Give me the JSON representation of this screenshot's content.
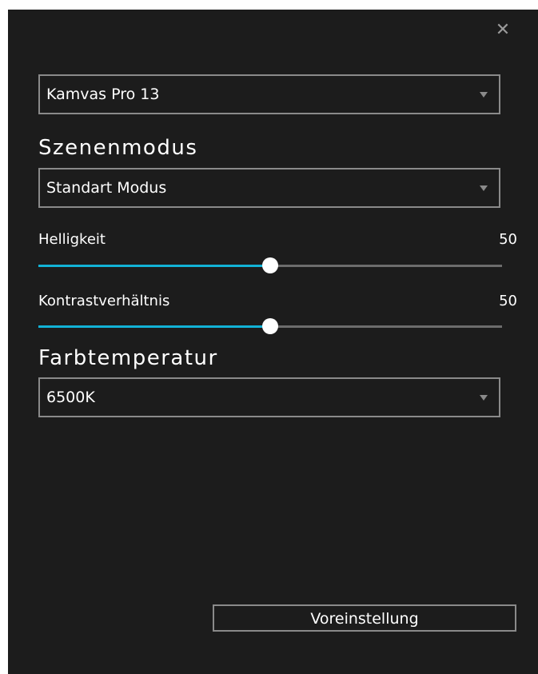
{
  "close_icon": "close-icon",
  "device_select": {
    "value": "Kamvas Pro 13"
  },
  "scene_mode": {
    "heading": "Szenenmodus",
    "value": "Standart Modus"
  },
  "brightness": {
    "label": "Helligkeit",
    "value": 50,
    "min": 0,
    "max": 100
  },
  "contrast": {
    "label": "Kontrastverhältnis",
    "value": 50,
    "min": 0,
    "max": 100
  },
  "color_temperature": {
    "heading": "Farbtemperatur",
    "value": "6500K"
  },
  "preset_button": {
    "label": "Voreinstellung"
  },
  "colors": {
    "panel_bg": "#1c1c1c",
    "accent": "#12b2d6",
    "border": "#8a8a8a"
  }
}
